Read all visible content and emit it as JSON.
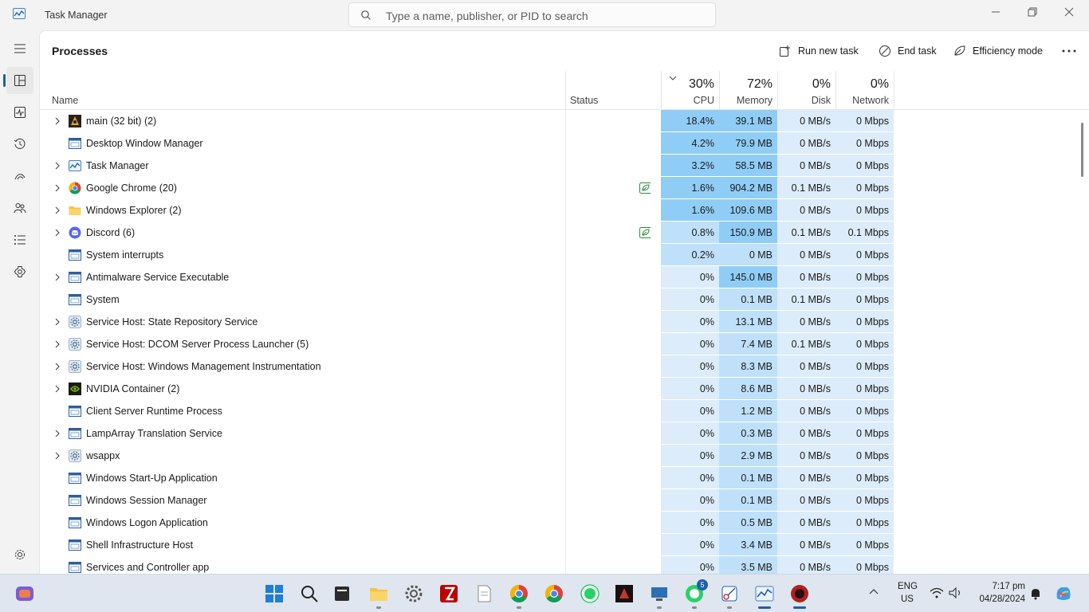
{
  "window": {
    "title": "Task Manager",
    "search_placeholder": "Type a name, publisher, or PID to search"
  },
  "nav": {
    "items": [
      {
        "icon": "hamburger-menu-icon"
      },
      {
        "icon": "processes-icon"
      },
      {
        "icon": "performance-icon"
      },
      {
        "icon": "app-history-icon"
      },
      {
        "icon": "startup-apps-icon"
      },
      {
        "icon": "users-icon"
      },
      {
        "icon": "details-icon"
      },
      {
        "icon": "services-icon"
      }
    ],
    "settings_icon": "gear-icon"
  },
  "page": {
    "title": "Processes",
    "actions": {
      "run_new_task": "Run new task",
      "end_task": "End task",
      "efficiency_mode": "Efficiency mode"
    }
  },
  "columns": {
    "name": "Name",
    "status": "Status",
    "cpu_pct": "30%",
    "cpu": "CPU",
    "memory_pct": "72%",
    "memory": "Memory",
    "disk_pct": "0%",
    "disk": "Disk",
    "network_pct": "0%",
    "network": "Network"
  },
  "heat_colors": {
    "light": "#dcecfa",
    "medium": "#bfe0fa",
    "strong": "#90cdf6"
  },
  "processes": [
    {
      "name": "main (32 bit) (2)",
      "expandable": true,
      "icon": "game-app-icon",
      "efficiency": false,
      "cpu": "18.4%",
      "memory": "39.1 MB",
      "disk": "0 MB/s",
      "network": "0 Mbps"
    },
    {
      "name": "Desktop Window Manager",
      "expandable": false,
      "icon": "window-app-icon",
      "efficiency": false,
      "cpu": "4.2%",
      "memory": "79.9 MB",
      "disk": "0 MB/s",
      "network": "0 Mbps"
    },
    {
      "name": "Task Manager",
      "expandable": true,
      "icon": "task-manager-icon",
      "efficiency": false,
      "cpu": "3.2%",
      "memory": "58.5 MB",
      "disk": "0 MB/s",
      "network": "0 Mbps"
    },
    {
      "name": "Google Chrome (20)",
      "expandable": true,
      "icon": "chrome-icon",
      "efficiency": true,
      "cpu": "1.6%",
      "memory": "904.2 MB",
      "disk": "0.1 MB/s",
      "network": "0 Mbps"
    },
    {
      "name": "Windows Explorer (2)",
      "expandable": true,
      "icon": "folder-icon",
      "efficiency": false,
      "cpu": "1.6%",
      "memory": "109.6 MB",
      "disk": "0 MB/s",
      "network": "0 Mbps"
    },
    {
      "name": "Discord (6)",
      "expandable": true,
      "icon": "discord-icon",
      "efficiency": true,
      "cpu": "0.8%",
      "memory": "150.9 MB",
      "disk": "0.1 MB/s",
      "network": "0.1 Mbps"
    },
    {
      "name": "System interrupts",
      "expandable": false,
      "icon": "window-app-icon",
      "efficiency": false,
      "cpu": "0.2%",
      "memory": "0 MB",
      "disk": "0 MB/s",
      "network": "0 Mbps"
    },
    {
      "name": "Antimalware Service Executable",
      "expandable": true,
      "icon": "window-app-icon",
      "efficiency": false,
      "cpu": "0%",
      "memory": "145.0 MB",
      "disk": "0 MB/s",
      "network": "0 Mbps"
    },
    {
      "name": "System",
      "expandable": false,
      "icon": "window-app-icon",
      "efficiency": false,
      "cpu": "0%",
      "memory": "0.1 MB",
      "disk": "0.1 MB/s",
      "network": "0 Mbps"
    },
    {
      "name": "Service Host: State Repository Service",
      "expandable": true,
      "icon": "service-gear-icon",
      "efficiency": false,
      "cpu": "0%",
      "memory": "13.1 MB",
      "disk": "0 MB/s",
      "network": "0 Mbps"
    },
    {
      "name": "Service Host: DCOM Server Process Launcher (5)",
      "expandable": true,
      "icon": "service-gear-icon",
      "efficiency": false,
      "cpu": "0%",
      "memory": "7.4 MB",
      "disk": "0.1 MB/s",
      "network": "0 Mbps"
    },
    {
      "name": "Service Host: Windows Management Instrumentation",
      "expandable": true,
      "icon": "service-gear-icon",
      "efficiency": false,
      "cpu": "0%",
      "memory": "8.3 MB",
      "disk": "0 MB/s",
      "network": "0 Mbps"
    },
    {
      "name": "NVIDIA Container (2)",
      "expandable": true,
      "icon": "nvidia-icon",
      "efficiency": false,
      "cpu": "0%",
      "memory": "8.6 MB",
      "disk": "0 MB/s",
      "network": "0 Mbps"
    },
    {
      "name": "Client Server Runtime Process",
      "expandable": false,
      "icon": "window-app-icon",
      "efficiency": false,
      "cpu": "0%",
      "memory": "1.2 MB",
      "disk": "0 MB/s",
      "network": "0 Mbps"
    },
    {
      "name": "LampArray Translation Service",
      "expandable": true,
      "icon": "window-app-icon",
      "efficiency": false,
      "cpu": "0%",
      "memory": "0.3 MB",
      "disk": "0 MB/s",
      "network": "0 Mbps"
    },
    {
      "name": "wsappx",
      "expandable": true,
      "icon": "service-gear-icon",
      "efficiency": false,
      "cpu": "0%",
      "memory": "2.9 MB",
      "disk": "0 MB/s",
      "network": "0 Mbps"
    },
    {
      "name": "Windows Start-Up Application",
      "expandable": false,
      "icon": "window-app-icon",
      "efficiency": false,
      "cpu": "0%",
      "memory": "0.1 MB",
      "disk": "0 MB/s",
      "network": "0 Mbps"
    },
    {
      "name": "Windows Session Manager",
      "expandable": false,
      "icon": "window-app-icon",
      "efficiency": false,
      "cpu": "0%",
      "memory": "0.1 MB",
      "disk": "0 MB/s",
      "network": "0 Mbps"
    },
    {
      "name": "Windows Logon Application",
      "expandable": false,
      "icon": "window-app-icon",
      "efficiency": false,
      "cpu": "0%",
      "memory": "0.5 MB",
      "disk": "0 MB/s",
      "network": "0 Mbps"
    },
    {
      "name": "Shell Infrastructure Host",
      "expandable": false,
      "icon": "window-app-icon",
      "efficiency": false,
      "cpu": "0%",
      "memory": "3.4 MB",
      "disk": "0 MB/s",
      "network": "0 Mbps"
    },
    {
      "name": "Services and Controller app",
      "expandable": false,
      "icon": "window-app-icon",
      "efficiency": false,
      "cpu": "0%",
      "memory": "3.5 MB",
      "disk": "0 MB/s",
      "network": "0 Mbps"
    }
  ],
  "taskbar": {
    "apps": [
      {
        "icon": "start-windows-icon"
      },
      {
        "icon": "search-icon"
      },
      {
        "icon": "file-manager-icon"
      },
      {
        "icon": "file-explorer-icon"
      },
      {
        "icon": "settings-icon"
      },
      {
        "icon": "filezilla-icon"
      },
      {
        "icon": "notepad-icon"
      },
      {
        "icon": "chrome-icon"
      },
      {
        "icon": "chrome-profile-icon"
      },
      {
        "icon": "whatsapp-icon"
      },
      {
        "icon": "game-icon"
      },
      {
        "icon": "remote-desktop-icon"
      },
      {
        "icon": "whatsapp-business-icon",
        "badge": "5"
      },
      {
        "icon": "snipping-tool-icon"
      },
      {
        "icon": "task-manager-icon"
      },
      {
        "icon": "game-launcher-icon"
      }
    ],
    "tray": {
      "language": "ENG",
      "region": "US",
      "time": "7:17 pm",
      "date": "04/28/2024"
    }
  }
}
